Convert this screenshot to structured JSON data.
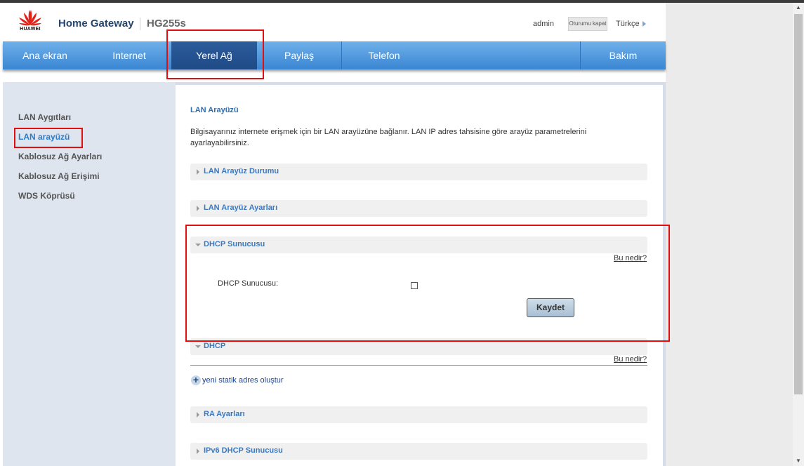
{
  "header": {
    "logo_text": "HUAWEI",
    "title": "Home Gateway",
    "model": "HG255s",
    "user": "admin",
    "logout_label": "Oturumu kapat",
    "language": "Türkçe"
  },
  "nav": {
    "items": [
      {
        "label": "Ana ekran"
      },
      {
        "label": "Internet"
      },
      {
        "label": "Yerel Ağ"
      },
      {
        "label": "Paylaş"
      },
      {
        "label": "Telefon"
      },
      {
        "label": "Bakım"
      }
    ],
    "active": "Yerel Ağ"
  },
  "sidebar": {
    "items": [
      {
        "label": "LAN Aygıtları"
      },
      {
        "label": "LAN arayüzü"
      },
      {
        "label": "Kablosuz Ağ Ayarları"
      },
      {
        "label": "Kablosuz Ağ Erişimi"
      },
      {
        "label": "WDS Köprüsü"
      }
    ],
    "active": "LAN arayüzü"
  },
  "content": {
    "title": "LAN Arayüzü",
    "description": "Bilgisayarınız internete erişmek için bir LAN arayüzüne bağlanır. LAN IP adres tahsisine göre arayüz parametrelerini ayarlayabilirsiniz.",
    "sections": [
      {
        "label": "LAN Arayüz Durumu",
        "expanded": false
      },
      {
        "label": "LAN Arayüz Ayarları",
        "expanded": false
      },
      {
        "label": "DHCP Sunucusu",
        "expanded": true
      },
      {
        "label": "DHCP",
        "expanded": true
      },
      {
        "label": "RA Ayarları",
        "expanded": false
      },
      {
        "label": "IPv6 DHCP Sunucusu",
        "expanded": false
      }
    ],
    "help_link": "Bu nedir?",
    "dhcp_server_label": "DHCP Sunucusu:",
    "dhcp_server_checked": false,
    "save_label": "Kaydet",
    "add_static_label": "yeni statik adres oluştur"
  },
  "colors": {
    "nav_blue": "#3a86d3",
    "nav_active": "#1f4a86",
    "annotation_red": "#e01010",
    "link_blue": "#3a78c0"
  }
}
